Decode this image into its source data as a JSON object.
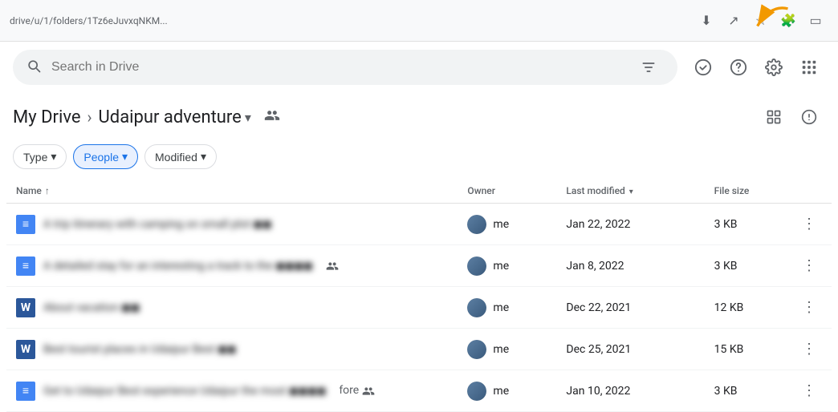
{
  "topbar": {
    "address": "drive/u/1/folders/1Tz6eJuvxqNKM..."
  },
  "search": {
    "placeholder": "Search in Drive",
    "value": ""
  },
  "breadcrumb": {
    "root": "My Drive",
    "current": "Udaipur adventure",
    "dropdown_arrow": "▾"
  },
  "filters": [
    {
      "id": "type",
      "label": "Type",
      "has_arrow": true
    },
    {
      "id": "people",
      "label": "People",
      "has_arrow": true,
      "active": true
    },
    {
      "id": "modified",
      "label": "Modified",
      "has_arrow": true
    }
  ],
  "table": {
    "columns": [
      {
        "id": "name",
        "label": "Name",
        "sortable": true,
        "sort_dir": "asc"
      },
      {
        "id": "owner",
        "label": "Owner",
        "sortable": false
      },
      {
        "id": "modified",
        "label": "Last modified",
        "sortable": true,
        "sort_active": true
      },
      {
        "id": "size",
        "label": "File size",
        "sortable": false
      }
    ],
    "rows": [
      {
        "id": 1,
        "icon_type": "docs",
        "icon_letter": "≡",
        "name_blurred": "A trip itinerary with camping on small plot  ◼◼",
        "shared": false,
        "shared_icon": "",
        "owner": "me",
        "modified": "Jan 22, 2022",
        "size": "3 KB"
      },
      {
        "id": 2,
        "icon_type": "docs",
        "icon_letter": "≡",
        "name_blurred": "A detailed stay for an interesting a track to the ◼◼◼◼",
        "shared": true,
        "shared_icon": "👥",
        "owner": "me",
        "modified": "Jan 8, 2022",
        "size": "3 KB"
      },
      {
        "id": 3,
        "icon_type": "word",
        "icon_letter": "W",
        "name_blurred": "About vacation  ◼◼",
        "shared": false,
        "shared_icon": "",
        "owner": "me",
        "modified": "Dec 22, 2021",
        "size": "12 KB"
      },
      {
        "id": 4,
        "icon_type": "word",
        "icon_letter": "W",
        "name_blurred": "Best tourist places in Udaipur Best  ◼◼",
        "shared": false,
        "shared_icon": "",
        "owner": "me",
        "modified": "Dec 25, 2021",
        "size": "15 KB"
      },
      {
        "id": 5,
        "icon_type": "docs",
        "icon_letter": "≡",
        "name_blurred": "Get to Udaipur Best experience Udaipur the most ◼◼◼◼",
        "shared": true,
        "shared_icon": "👥",
        "owner": "me",
        "modified": "Jan 10, 2022",
        "size": "3 KB",
        "shared_text": "fore"
      }
    ]
  },
  "icons": {
    "search": "🔍",
    "filter_lines": "⚙",
    "check_circle": "✓",
    "help": "?",
    "settings": "⚙",
    "apps_grid": "⋮⋮",
    "download": "⬇",
    "share": "↗",
    "star": "☆",
    "puzzle": "🧩",
    "sidebar": "▭",
    "grid_view": "▦",
    "info": "ⓘ",
    "share_people": "👤+",
    "dropdown": "▾",
    "more_vert": "⋮",
    "sort_asc": "↑"
  }
}
